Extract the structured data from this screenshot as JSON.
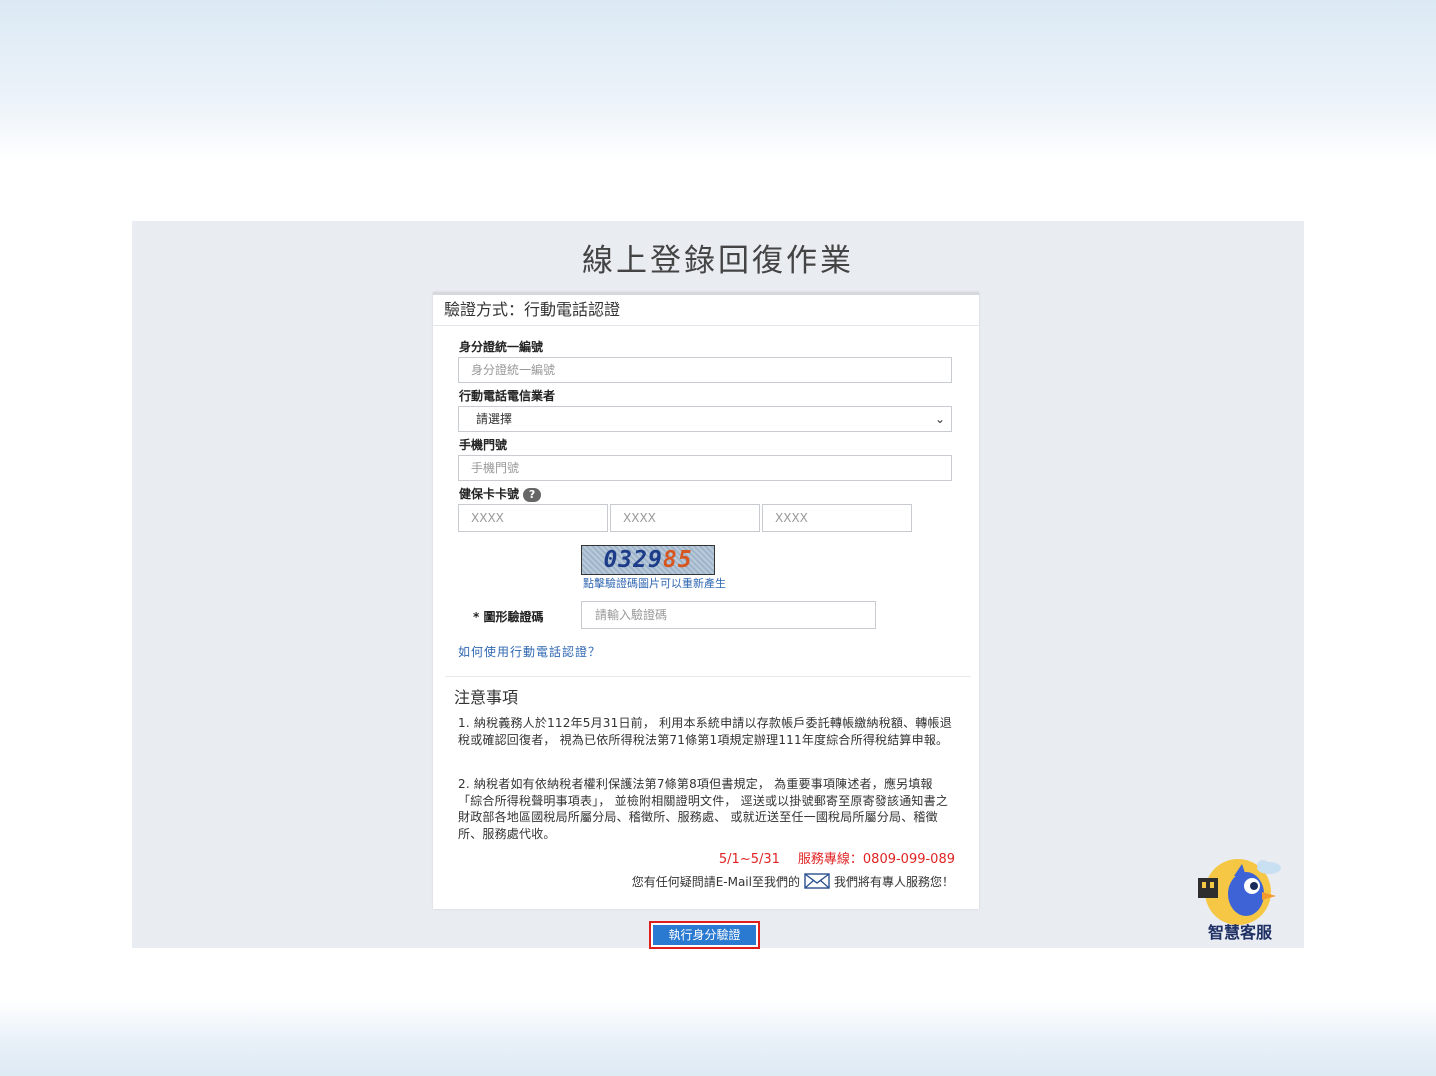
{
  "page": {
    "title": "線上登錄回復作業"
  },
  "form": {
    "header": "驗證方式：行動電話認證",
    "id_label": "身分證統一編號",
    "id_placeholder": "身分證統一編號",
    "carrier_label": "行動電話電信業者",
    "carrier_selected": "請選擇",
    "phone_label": "手機門號",
    "phone_placeholder": "手機門號",
    "card_label": "健保卡卡號",
    "card_help": "?",
    "card_placeholders": [
      "XXXX",
      "XXXX",
      "XXXX"
    ],
    "captcha_digits_a": "0329",
    "captcha_digits_b": "85",
    "captcha_hint": "點擊驗證碼圖片可以重新產生",
    "captcha_required_mark": "*",
    "captcha_label": "圖形驗證碼",
    "captcha_placeholder": "請輸入驗證碼",
    "howto_link": "如何使用行動電話認證？"
  },
  "notes": {
    "title": "注意事項",
    "items": [
      "1. 納稅義務人於112年5月31日前， 利用本系統申請以存款帳戶委託轉帳繳納稅額、轉帳退稅或確認回復者， 視為已依所得稅法第71條第1項規定辦理111年度綜合所得稅結算申報。",
      "2. 納稅者如有依納稅者權利保護法第7條第8項但書規定， 為重要事項陳述者，應另填報「綜合所得稅聲明事項表」， 並檢附相關證明文件， 逕送或以掛號郵寄至原寄發該通知書之財政部各地區國稅局所屬分局、稽徵所、服務處、 或就近送至任一國稅局所屬分局、稽徵所、服務處代收。"
    ],
    "hotline_period": "5/1~5/31",
    "hotline_text": "服務專線：0809-099-089",
    "contact_before": "您有任何疑問請E-Mail至我們的",
    "contact_after": "我們將有專人服務您！"
  },
  "actions": {
    "submit_label": "執行身分驗證"
  },
  "assistant": {
    "label": "智慧客服"
  },
  "colors": {
    "accent": "#2b7ad2",
    "highlight_border": "#e01d1d",
    "hotline": "#e02323",
    "link": "#2f67b2"
  }
}
